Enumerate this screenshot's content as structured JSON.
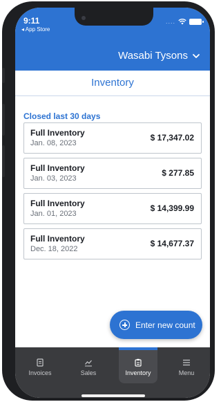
{
  "status_bar": {
    "time": "9:11",
    "back_app": "◂ App Store",
    "dots": "...."
  },
  "header": {
    "store_name": "Wasabi Tysons"
  },
  "page": {
    "title": "Inventory"
  },
  "section": {
    "label": "Closed last 30 days"
  },
  "counts": [
    {
      "name": "Full Inventory",
      "date": "Jan. 08, 2023",
      "amount": "$ 17,347.02"
    },
    {
      "name": "Full Inventory",
      "date": "Jan. 03, 2023",
      "amount": "$ 277.85"
    },
    {
      "name": "Full Inventory",
      "date": "Jan. 01, 2023",
      "amount": "$ 14,399.99"
    },
    {
      "name": "Full Inventory",
      "date": "Dec. 18, 2022",
      "amount": "$ 14,677.37"
    }
  ],
  "fab": {
    "label": "Enter new count"
  },
  "tabs": [
    {
      "label": "Invoices",
      "icon": "invoice-icon",
      "active": false
    },
    {
      "label": "Sales",
      "icon": "chart-icon",
      "active": false
    },
    {
      "label": "Inventory",
      "icon": "clipboard-icon",
      "active": true
    },
    {
      "label": "Menu",
      "icon": "hamburger-icon",
      "active": false
    }
  ],
  "colors": {
    "brand": "#2d73d2",
    "tabbar": "#3a3b3e"
  }
}
